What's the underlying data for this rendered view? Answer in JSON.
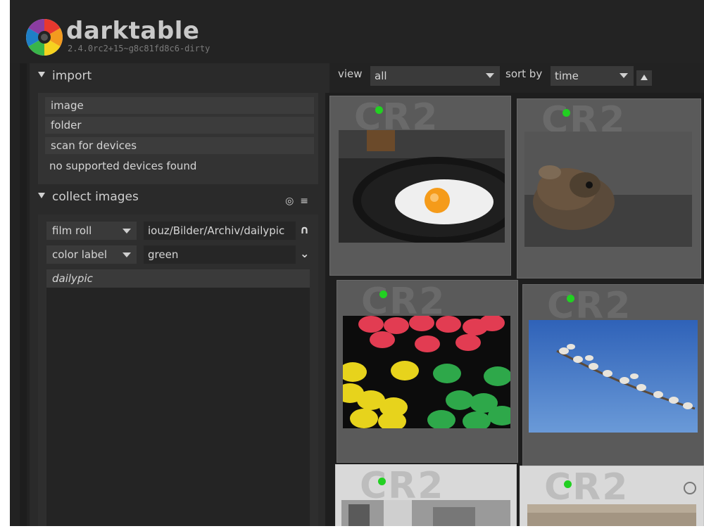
{
  "app": {
    "name": "darktable",
    "version": "2.4.0rc2+15~g8c81fd8c6-dirty"
  },
  "import": {
    "title": "import",
    "buttons": [
      "image",
      "folder",
      "scan for devices"
    ],
    "status": "no supported devices found"
  },
  "collect": {
    "title": "collect images",
    "rules": [
      {
        "property": "film roll",
        "value": "iouz/Bilder/Archiv/dailypic",
        "icon": "up-arrow-icon"
      },
      {
        "property": "color label",
        "value": "green",
        "icon": "chevron-down-icon"
      }
    ],
    "results": [
      "dailypic"
    ]
  },
  "toolbar": {
    "view_label": "view",
    "view_value": "all",
    "sort_label": "sort by",
    "sort_value": "time"
  },
  "thumbnails": [
    {
      "format": "CR2",
      "color_label": "green",
      "subject": "fried-egg"
    },
    {
      "format": "CR2",
      "color_label": "green",
      "subject": "bird-figurine"
    },
    {
      "format": "CR2",
      "color_label": "green",
      "subject": "guitar-picks"
    },
    {
      "format": "CR2",
      "color_label": "green",
      "subject": "catkin-branch"
    },
    {
      "format": "CR2",
      "color_label": "green",
      "subject": "building"
    },
    {
      "format": "CR2",
      "color_label": "green",
      "subject": "gravel"
    }
  ],
  "colors": {
    "label_green": "#22d022",
    "background": "#222222"
  }
}
